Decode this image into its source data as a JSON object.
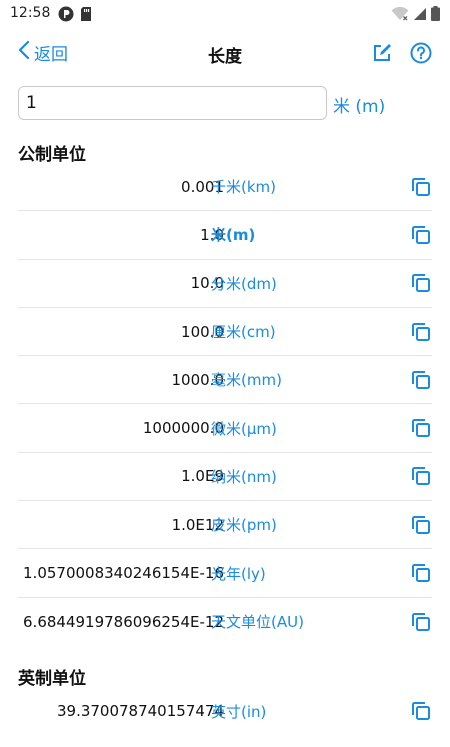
{
  "status_bar": {
    "time": "12:58",
    "icons_left": [
      "app-notification-icon",
      "sd-card-icon"
    ],
    "icons_right": [
      "wifi-icon",
      "cellular-signal-icon",
      "battery-icon"
    ]
  },
  "toolbar": {
    "back_label": "返回",
    "title": "长度"
  },
  "input": {
    "value": "1",
    "unit": "米 (m)"
  },
  "sections": [
    {
      "title": "公制单位",
      "rows": [
        {
          "value": "0.001",
          "unit": "千米(km)"
        },
        {
          "value": "1.0",
          "unit": "米(m)",
          "selected": true
        },
        {
          "value": "10.0",
          "unit": "分米(dm)"
        },
        {
          "value": "100.0",
          "unit": "厘米(cm)"
        },
        {
          "value": "1000.0",
          "unit": "毫米(mm)"
        },
        {
          "value": "1000000.0",
          "unit": "微米(μm)"
        },
        {
          "value": "1.0E9",
          "unit": "纳米(nm)"
        },
        {
          "value": "1.0E12",
          "unit": "皮米(pm)"
        },
        {
          "value": "1.0570008340246154E-16",
          "unit": "光年(ly)"
        },
        {
          "value": "6.6844919786096254E-12",
          "unit": "天文单位(AU)"
        }
      ]
    },
    {
      "title": "英制单位",
      "rows": [
        {
          "value": "39.370078740157474",
          "unit": "英寸(in)"
        }
      ]
    }
  ],
  "colors": {
    "accent": "#1a8be0",
    "divider": "#e4e4e4"
  }
}
